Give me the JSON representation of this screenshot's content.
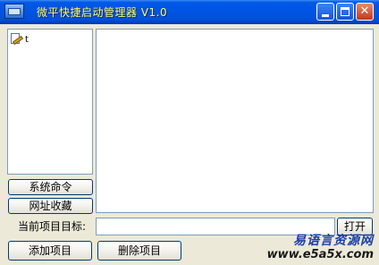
{
  "window": {
    "title": "微平快捷启动管理器 V1.0",
    "title_color": "#ffff66",
    "titlebar_color": "#0054e3",
    "buttons": {
      "minimize": "minimize-icon",
      "maximize": "maximize-icon",
      "close": "✕"
    }
  },
  "tree": {
    "items": [
      {
        "label": "t",
        "icon": "document-pen-icon"
      }
    ]
  },
  "left_buttons": {
    "system_commands": "系统命令",
    "url_favorites": "网址收藏"
  },
  "target": {
    "label": "当前项目目标:",
    "value": "",
    "open_button": "打开"
  },
  "bottom_buttons": {
    "add_item": "添加项目",
    "delete_item": "删除项目"
  },
  "watermark": {
    "line1": "易语言资源网",
    "line2": "www.e5a5x.com"
  }
}
